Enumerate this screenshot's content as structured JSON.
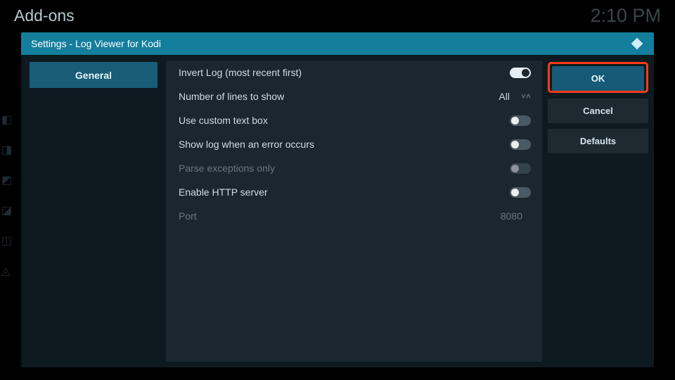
{
  "bg": {
    "title": "Add-ons",
    "time": "2:10 PM"
  },
  "dialog": {
    "title": "Settings - Log Viewer for Kodi",
    "sidebar": {
      "items": [
        {
          "label": "General",
          "selected": true
        }
      ]
    },
    "settings": [
      {
        "key": "invert_log",
        "label": "Invert Log (most recent first)",
        "type": "toggle",
        "value": true,
        "disabled": false
      },
      {
        "key": "num_lines",
        "label": "Number of lines to show",
        "type": "spinner",
        "value": "All",
        "disabled": false
      },
      {
        "key": "custom_box",
        "label": "Use custom text box",
        "type": "toggle",
        "value": false,
        "disabled": false
      },
      {
        "key": "show_on_err",
        "label": "Show log when an error occurs",
        "type": "toggle",
        "value": false,
        "disabled": false
      },
      {
        "key": "parse_exc",
        "label": "Parse exceptions only",
        "type": "toggle",
        "value": false,
        "disabled": true
      },
      {
        "key": "http_server",
        "label": "Enable HTTP server",
        "type": "toggle",
        "value": false,
        "disabled": false
      },
      {
        "key": "port",
        "label": "Port",
        "type": "number",
        "value": "8080",
        "disabled": true
      }
    ],
    "actions": {
      "ok": "OK",
      "cancel": "Cancel",
      "defaults": "Defaults"
    }
  }
}
